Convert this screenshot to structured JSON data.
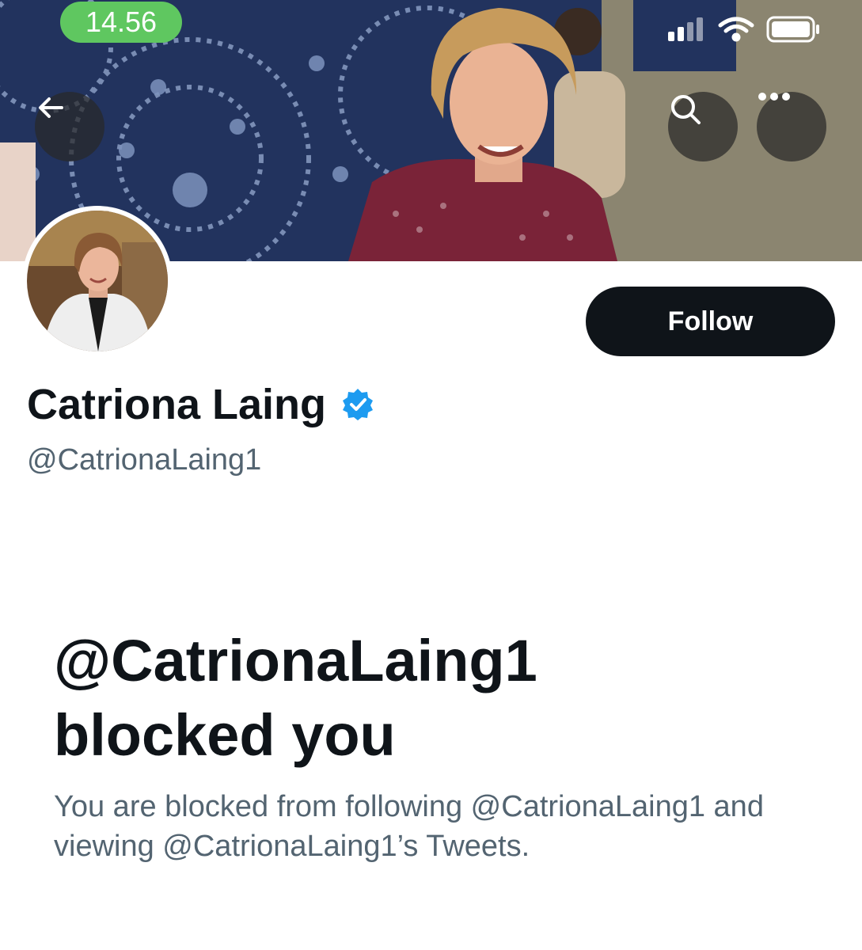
{
  "status_bar": {
    "time": "14.56"
  },
  "header": {
    "back_icon": "arrow-left-icon",
    "search_icon": "search-icon",
    "more_icon": "more-horizontal-icon"
  },
  "profile": {
    "display_name": "Catriona Laing",
    "verified_icon": "verified-badge-icon",
    "handle": "@CatrionaLaing1",
    "follow_label": "Follow"
  },
  "blocked": {
    "title_line1": "@CatrionaLaing1",
    "title_line2": "blocked you",
    "description": "You are blocked from following @CatrionaLaing1 and viewing @CatrionaLaing1’s Tweets."
  },
  "colors": {
    "primary_text": "#0f1419",
    "secondary_text": "#536471",
    "verified_blue": "#1d9bf0",
    "follow_bg": "#0f1419",
    "time_pill": "#5fc760"
  }
}
